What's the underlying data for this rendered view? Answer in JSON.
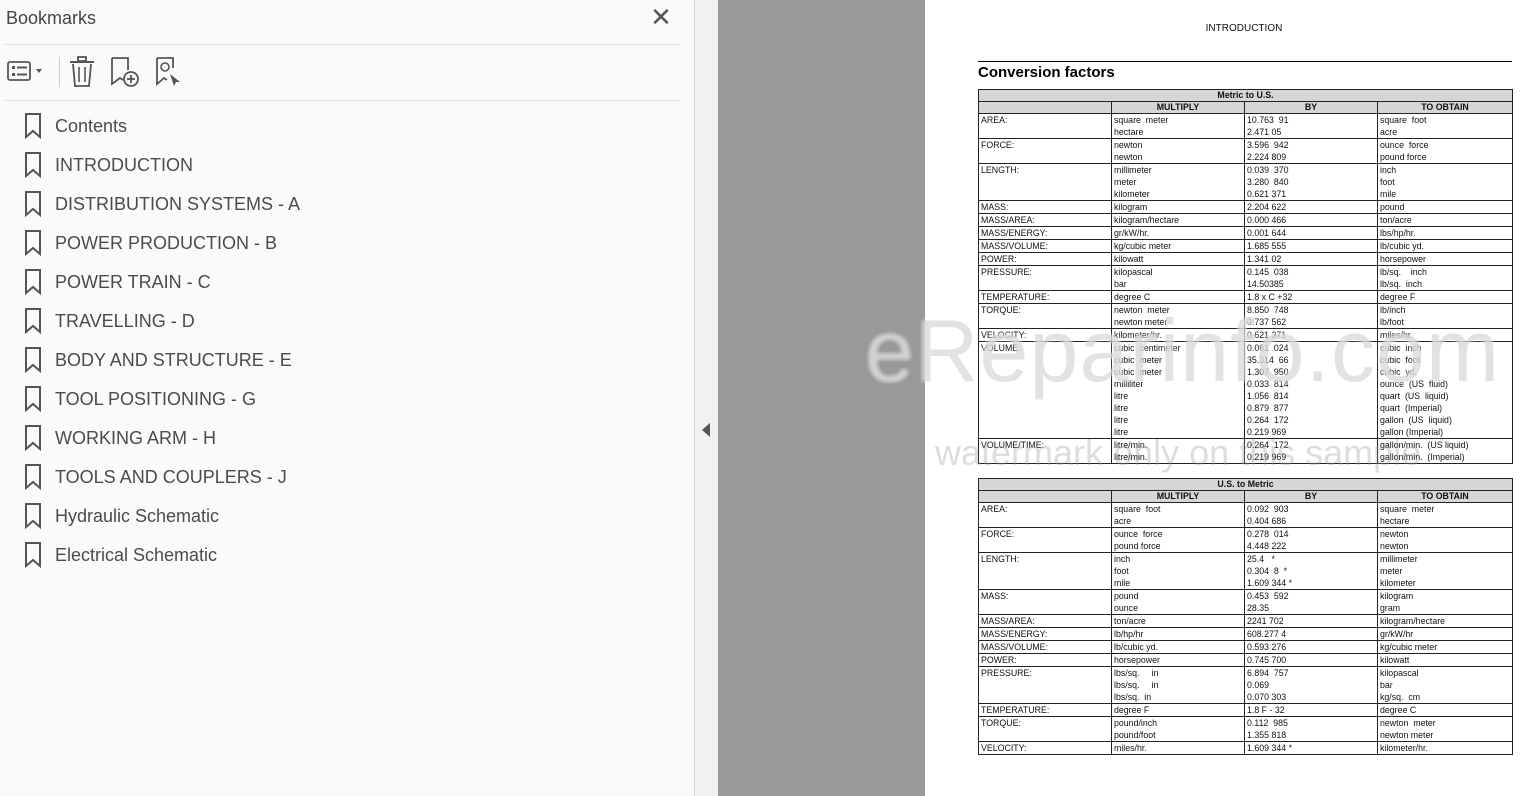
{
  "panel": {
    "title": "Bookmarks",
    "close_label": "✕",
    "toolbar": [
      "options-menu",
      "delete-bookmark",
      "new-bookmark",
      "find-bookmark"
    ],
    "items": [
      {
        "label": "Contents"
      },
      {
        "label": "INTRODUCTION"
      },
      {
        "label": "DISTRIBUTION SYSTEMS - A"
      },
      {
        "label": "POWER PRODUCTION - B"
      },
      {
        "label": "POWER TRAIN - C"
      },
      {
        "label": "TRAVELLING - D"
      },
      {
        "label": "BODY AND STRUCTURE - E"
      },
      {
        "label": "TOOL POSITIONING - G"
      },
      {
        "label": "WORKING ARM - H"
      },
      {
        "label": "TOOLS AND COUPLERS - J"
      },
      {
        "label": "Hydraulic Schematic"
      },
      {
        "label": "Electrical Schematic"
      }
    ]
  },
  "document": {
    "header": "INTRODUCTION",
    "heading": "Conversion factors",
    "tables": [
      {
        "title": "Metric to U.S.",
        "columns": [
          "MULTIPLY",
          "BY",
          "TO OBTAIN"
        ],
        "groups": [
          {
            "quantity": "AREA:",
            "rows": [
              [
                "square  meter",
                "10.763  91",
                "square  foot"
              ],
              [
                "hectare",
                "2.471 05",
                "acre"
              ]
            ]
          },
          {
            "quantity": "FORCE:",
            "rows": [
              [
                "newton",
                "3.596  942",
                "ounce  force"
              ],
              [
                "newton",
                "2.224 809",
                "pound force"
              ]
            ]
          },
          {
            "quantity": "LENGTH:",
            "rows": [
              [
                "millimeter",
                "0.039  370",
                "inch"
              ],
              [
                "meter",
                "3.280  840",
                "foot"
              ],
              [
                "kilometer",
                "0.621 371",
                "mile"
              ]
            ]
          },
          {
            "quantity": "MASS:",
            "rows": [
              [
                "kilogram",
                "2.204 622",
                "pound"
              ]
            ]
          },
          {
            "quantity": "MASS/AREA:",
            "rows": [
              [
                "kilogram/hectare",
                "0.000 466",
                "ton/acre"
              ]
            ]
          },
          {
            "quantity": "MASS/ENERGY:",
            "rows": [
              [
                "gr/kW/hr.",
                "0.001 644",
                "lbs/hp/hr."
              ]
            ]
          },
          {
            "quantity": "MASS/VOLUME:",
            "rows": [
              [
                "kg/cubic meter",
                "1.685 555",
                "lb/cubic yd."
              ]
            ]
          },
          {
            "quantity": "POWER:",
            "rows": [
              [
                "kilowatt",
                "1.341 02",
                "horsepower"
              ]
            ]
          },
          {
            "quantity": "PRESSURE:",
            "rows": [
              [
                "kilopascal",
                "0.145  038",
                "lb/sq.    inch"
              ],
              [
                "bar",
                "14.50385",
                "lb/sq.  inch"
              ]
            ]
          },
          {
            "quantity": "TEMPERATURE:",
            "rows": [
              [
                "degree C",
                "1.8 x C +32",
                "degree F"
              ]
            ]
          },
          {
            "quantity": "TORQUE:",
            "rows": [
              [
                "newton  meter",
                "8.850  748",
                "lb/inch"
              ],
              [
                "newton meter",
                "0.737 562",
                "lb/foot"
              ]
            ]
          },
          {
            "quantity": "VELOCITY:",
            "rows": [
              [
                "kilometer/hr.",
                "0.621 371",
                "miles/hr."
              ]
            ]
          },
          {
            "quantity": "VOLUME:",
            "rows": [
              [
                "cubic  centimeter",
                "0.061  024",
                "cubic  inch"
              ],
              [
                "cubic  meter",
                "35.314  66",
                "cubic  foot"
              ],
              [
                "cubic  meter",
                "1.307  950",
                "cubic  yd."
              ],
              [
                "milliliter",
                "0.033  814",
                "ounce  (US  fluid)"
              ],
              [
                "litre",
                "1.056  814",
                "quart  (US  liquid)"
              ],
              [
                "litre",
                "0.879  877",
                "quart  (Imperial)"
              ],
              [
                "litre",
                "0.264  172",
                "gallon  (US  liquid)"
              ],
              [
                "litre",
                "0.219 969",
                "gallon (Imperial)"
              ]
            ]
          },
          {
            "quantity": "VOLUME/TIME:",
            "rows": [
              [
                "litre/min.",
                "0.264  172",
                "gallon/min.  (US liquid)"
              ],
              [
                "litre/min.",
                "0.219 969",
                "gallon/min.  (Imperial)"
              ]
            ]
          }
        ]
      },
      {
        "title": "U.S. to Metric",
        "columns": [
          "MULTIPLY",
          "BY",
          "TO OBTAIN"
        ],
        "groups": [
          {
            "quantity": "AREA:",
            "rows": [
              [
                "square  foot",
                "0.092  903",
                "square  meter"
              ],
              [
                "acre",
                "0.404 686",
                "hectare"
              ]
            ]
          },
          {
            "quantity": "FORCE:",
            "rows": [
              [
                "ounce  force",
                "0.278  014",
                "newton"
              ],
              [
                "pound force",
                "4.448 222",
                "newton"
              ]
            ]
          },
          {
            "quantity": "LENGTH:",
            "rows": [
              [
                "inch",
                "25.4   *",
                "millimeter"
              ],
              [
                "foot",
                "0.304  8  *",
                "meter"
              ],
              [
                "mile",
                "1.609 344 *",
                "kilometer"
              ]
            ]
          },
          {
            "quantity": "MASS:",
            "rows": [
              [
                "pound",
                "0.453  592",
                "kilogram"
              ],
              [
                "ounce",
                "28.35",
                "gram"
              ]
            ]
          },
          {
            "quantity": "MASS/AREA:",
            "rows": [
              [
                "ton/acre",
                "2241 702",
                "kilogram/hectare"
              ]
            ]
          },
          {
            "quantity": "MASS/ENERGY:",
            "rows": [
              [
                "lb/hp/hr",
                "608.277 4",
                "gr/kW/hr"
              ]
            ]
          },
          {
            "quantity": "MASS/VOLUME:",
            "rows": [
              [
                "lb/cubic yd.",
                "0.593 276",
                "kg/cubic meter"
              ]
            ]
          },
          {
            "quantity": "POWER:",
            "rows": [
              [
                "horsepower",
                "0.745 700",
                "kilowatt"
              ]
            ]
          },
          {
            "quantity": "PRESSURE:",
            "rows": [
              [
                "lbs/sq.     in",
                "6.894  757",
                "kilopascal"
              ],
              [
                "lbs/sq.     in",
                "0.069",
                "bar"
              ],
              [
                "lbs/sq.  in",
                "0.070 303",
                "kg/sq.  cm"
              ]
            ]
          },
          {
            "quantity": "TEMPERATURE:",
            "rows": [
              [
                "degree F",
                "1.8 F - 32",
                "degree C"
              ]
            ]
          },
          {
            "quantity": "TORQUE:",
            "rows": [
              [
                "pound/inch",
                "0.112  985",
                "newton  meter"
              ],
              [
                "pound/foot",
                "1.355 818",
                "newton meter"
              ]
            ]
          },
          {
            "quantity": "VELOCITY:",
            "rows": [
              [
                "miles/hr.",
                "1.609 344 *",
                "kilometer/hr."
              ]
            ]
          }
        ]
      }
    ],
    "watermark_line1": "eReparinfo.com",
    "watermark_line2": "watermark only on this sample"
  }
}
